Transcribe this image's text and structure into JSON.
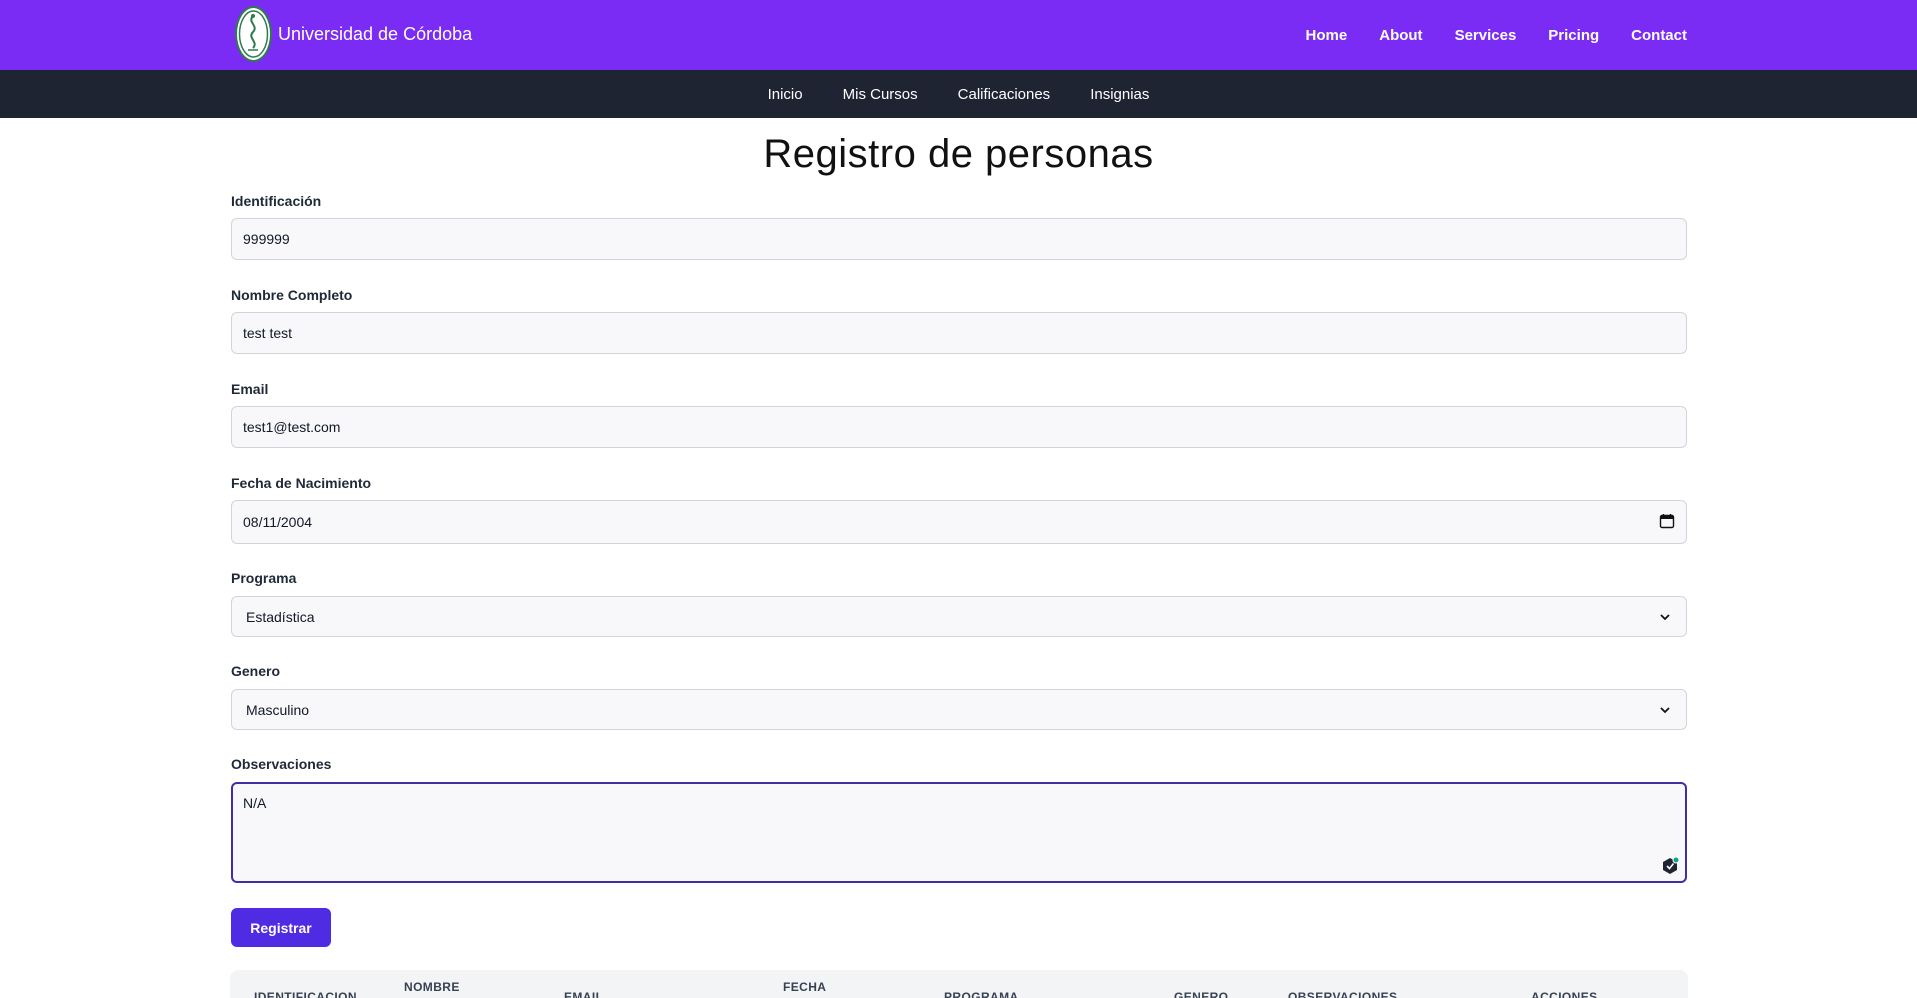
{
  "header": {
    "brand": "Universidad de Córdoba",
    "nav": [
      "Home",
      "About",
      "Services",
      "Pricing",
      "Contact"
    ]
  },
  "subnav": [
    "Inicio",
    "Mis Cursos",
    "Calificaciones",
    "Insignias"
  ],
  "page_title": "Registro de personas",
  "form": {
    "identificacion": {
      "label": "Identificación",
      "value": "999999"
    },
    "nombre": {
      "label": "Nombre Completo",
      "value": "test test"
    },
    "email": {
      "label": "Email",
      "value": "test1@test.com"
    },
    "fecha": {
      "label": "Fecha de Nacimiento",
      "value": "08/11/2004"
    },
    "programa": {
      "label": "Programa",
      "value": "Estadística"
    },
    "genero": {
      "label": "Genero",
      "value": "Masculino"
    },
    "observaciones": {
      "label": "Observaciones",
      "value": "N/A"
    },
    "submit_label": "Registrar"
  },
  "table": {
    "headers": {
      "identificacion": "IDENTIFICACION",
      "nombre": "NOMBRE",
      "email": "EMAIL",
      "fecha": "FECHA",
      "programa": "PROGRAMA",
      "genero": "GENERO",
      "observaciones": "OBSERVACIONES",
      "acciones": "ACCIONES"
    }
  },
  "colors": {
    "topbar": "#7a2cf5",
    "subbar": "#1f2433",
    "button": "#4f2be3"
  }
}
